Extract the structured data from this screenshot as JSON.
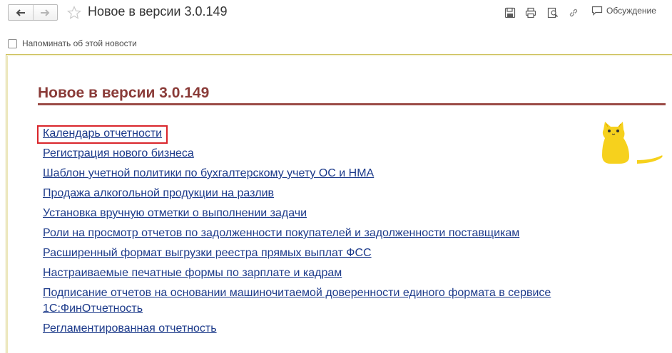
{
  "window": {
    "title": "Новое в версии 3.0.149"
  },
  "toolbar": {
    "back_icon": "arrow-left-icon",
    "forward_icon": "arrow-right-icon",
    "favorite_icon": "star-icon",
    "save_icon": "floppy-disk-icon",
    "print_icon": "printer-icon",
    "preview_icon": "print-preview-icon",
    "link_icon": "link-icon",
    "discussion_icon": "speech-bubble-icon",
    "discussion_label": "Обсуждение"
  },
  "reminder": {
    "label": "Напоминать об этой новости",
    "checked": false
  },
  "content": {
    "heading": "Новое в версии 3.0.149",
    "heading_color": "#8a3b38",
    "link_color": "#1c3a8a",
    "highlight_color": "#d9252b",
    "mascot": "cat-mascot",
    "links": [
      "Календарь отчетности",
      "Регистрация нового бизнеса",
      "Шаблон учетной политики по бухгалтерскому учету ОС и НМА",
      "Продажа алкогольной продукции на разлив",
      "Установка вручную отметки о выполнении задачи",
      "Роли на просмотр отчетов по задолженности покупателей и задолженности поставщикам",
      "Расширенный формат выгрузки реестра прямых выплат ФСС",
      "Настраиваемые печатные формы по зарплате и кадрам",
      "Подписание отчетов на основании машиночитаемой доверенности единого формата в сервисе 1С:ФинОтчетность",
      "Регламентированная отчетность"
    ]
  }
}
